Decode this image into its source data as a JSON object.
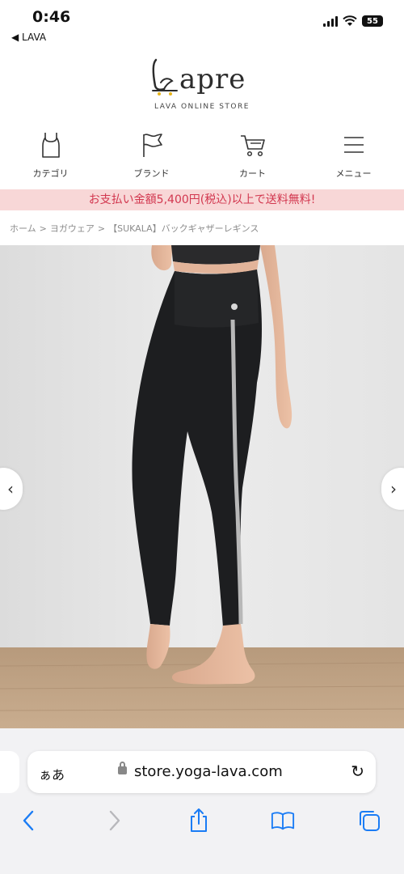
{
  "status_bar": {
    "time": "0:46",
    "back_app": "◀ LAVA",
    "battery": "55"
  },
  "logo": {
    "text": "apre",
    "subtitle": "LAVA ONLINE STORE"
  },
  "nav": {
    "items": [
      {
        "label": "カテゴリ",
        "icon": "tank-top-icon"
      },
      {
        "label": "ブランド",
        "icon": "flag-icon"
      },
      {
        "label": "カート",
        "icon": "cart-icon"
      },
      {
        "label": "メニュー",
        "icon": "hamburger-icon"
      }
    ]
  },
  "promo": {
    "text": "お支払い金額5,400円(税込)以上で送料無料!"
  },
  "breadcrumb": {
    "items": [
      "ホーム",
      ">",
      "ヨガウェア",
      ">",
      "【SUKALA】バックギャザーレギンス"
    ]
  },
  "hero": {
    "prev": "‹",
    "next": "›"
  },
  "browser": {
    "aa": "ぁあ",
    "url": "store.yoga-lava.com",
    "reload": "↻"
  },
  "colors": {
    "promo_bg": "#f8d7d7",
    "promo_text": "#d2374f",
    "ios_blue": "#1a7cf5"
  }
}
